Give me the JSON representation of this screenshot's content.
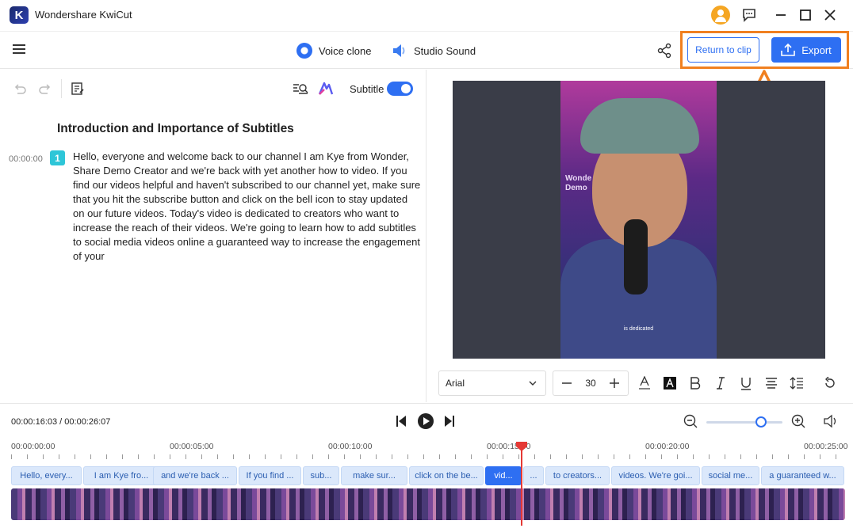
{
  "app": {
    "title": "Wondershare KwiCut",
    "logo_letter": "K"
  },
  "toolbar": {
    "voice_clone": "Voice clone",
    "studio_sound": "Studio Sound",
    "return_to_clip": "Return to clip",
    "export": "Export"
  },
  "editor": {
    "subtitle_label": "Subtitle",
    "subtitle_enabled": true,
    "doc_title": "Introduction and Importance of Subtitles",
    "segments": [
      {
        "time": "00:00:00",
        "index": "1",
        "text": "Hello, everyone and welcome back to our channel I am Kye from Wonder, Share Demo Creator and we're back with yet another how to video. If you find our videos helpful and haven't subscribed to our channel yet, make sure that you hit the subscribe button and click on the bell icon to stay updated on our future videos. Today's video is dedicated to creators who want to increase the reach of their videos. We're going to learn how to add subtitles to social media videos online a guaranteed way to increase the engagement of your"
      }
    ]
  },
  "preview": {
    "caption": "is dedicated",
    "brand_text": "Wonde\nDemo"
  },
  "format": {
    "font": "Arial",
    "size": "30"
  },
  "playback": {
    "timecode": "00:00:16:03 / 00:00:26:07",
    "zoom_level": 0.72
  },
  "timeline": {
    "ticks": [
      "00:00:00:00",
      "00:00:05:00",
      "00:00:10:00",
      "00:00:15:00",
      "00:00:20:00",
      "00:00:25:00"
    ],
    "clips": [
      "Hello, every...",
      "I am Kye fro...",
      "and we're back ...",
      "If you find ...",
      "sub...",
      "make sur...",
      "click on the be...",
      "vid...",
      "...",
      "to creators...",
      "videos. We're goi...",
      "social me...",
      "a guaranteed w..."
    ],
    "active_clip_index": 7
  },
  "colors": {
    "accent": "#2e6ff2",
    "highlight": "#f08020",
    "playhead": "#e53935"
  }
}
